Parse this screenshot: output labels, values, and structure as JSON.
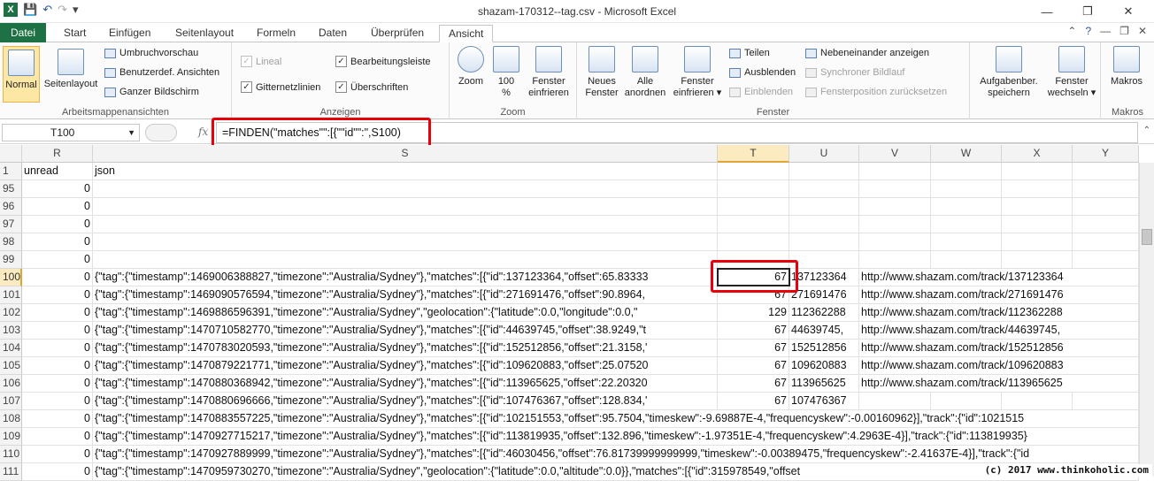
{
  "window": {
    "title": "shazam-170312--tag.csv - Microsoft Excel"
  },
  "qat": {
    "save": "💾",
    "undo": "↶",
    "redo": "↷",
    "customize": "▾"
  },
  "window_controls": {
    "min": "—",
    "restore": "❐",
    "close": "✕"
  },
  "tabs": [
    "Datei",
    "Start",
    "Einfügen",
    "Seitenlayout",
    "Formeln",
    "Daten",
    "Überprüfen",
    "Ansicht"
  ],
  "active_tab": "Ansicht",
  "ribbon": {
    "groups": {
      "arbeitsmappen": "Arbeitsmappenansichten",
      "anzeigen": "Anzeigen",
      "zoom": "Zoom",
      "fenster": "Fenster",
      "makros": "Makros"
    },
    "normal": "Normal",
    "seitenlayout": "Seitenlayout",
    "umbruch": "Umbruchvorschau",
    "benutzer": "Benutzerdef. Ansichten",
    "ganzer": "Ganzer Bildschirm",
    "lineal": "Lineal",
    "gitternetz": "Gitternetzlinien",
    "bearbeitung": "Bearbeitungsleiste",
    "ueberschriften": "Überschriften",
    "zoom": "Zoom",
    "zoom100a": "100",
    "zoom100b": "%",
    "fenster_einfrieren1": "Fenster",
    "fenster_einfrieren2": "einfrieren",
    "neues_fenster1": "Neues",
    "neues_fenster2": "Fenster",
    "alle_anordnen1": "Alle",
    "alle_anordnen2": "anordnen",
    "fenster_einfr_dd1": "Fenster",
    "fenster_einfr_dd2": "einfrieren ▾",
    "teilen": "Teilen",
    "ausblenden": "Ausblenden",
    "einblenden": "Einblenden",
    "nebeneinander": "Nebeneinander anzeigen",
    "synchron": "Synchroner Bildlauf",
    "fensterpos": "Fensterposition zurücksetzen",
    "aufgaben1": "Aufgabenber.",
    "aufgaben2": "speichern",
    "wechseln1": "Fenster",
    "wechseln2": "wechseln ▾",
    "makros": "Makros"
  },
  "formula_bar": {
    "name_box": "T100",
    "fx": "fx",
    "formula": "=FINDEN(\"matches\"\":[{\"\"id\"\":\",S100)"
  },
  "columns": [
    "R",
    "S",
    "T",
    "U",
    "V",
    "W",
    "X",
    "Y"
  ],
  "selected_column": "T",
  "header_row": {
    "row": "1",
    "R": "unread",
    "S": "json"
  },
  "rows": [
    {
      "n": "95",
      "R": "0",
      "S": "",
      "T": "",
      "U": "",
      "V": ""
    },
    {
      "n": "96",
      "R": "0",
      "S": "",
      "T": "",
      "U": "",
      "V": ""
    },
    {
      "n": "97",
      "R": "0",
      "S": "",
      "T": "",
      "U": "",
      "V": ""
    },
    {
      "n": "98",
      "R": "0",
      "S": "",
      "T": "",
      "U": "",
      "V": ""
    },
    {
      "n": "99",
      "R": "0",
      "S": "",
      "T": "",
      "U": "",
      "V": ""
    },
    {
      "n": "100",
      "R": "0",
      "S": "{\"tag\":{\"timestamp\":1469006388827,\"timezone\":\"Australia/Sydney\"},\"matches\":[{\"id\":137123364,\"offset\":65.83333",
      "T": "67",
      "U": "137123364",
      "V": "http://www.shazam.com/track/137123364"
    },
    {
      "n": "101",
      "R": "0",
      "S": "{\"tag\":{\"timestamp\":1469090576594,\"timezone\":\"Australia/Sydney\"},\"matches\":[{\"id\":271691476,\"offset\":90.8964,",
      "T": "67",
      "U": "271691476",
      "V": "http://www.shazam.com/track/271691476"
    },
    {
      "n": "102",
      "R": "0",
      "S": "{\"tag\":{\"timestamp\":1469886596391,\"timezone\":\"Australia/Sydney\",\"geolocation\":{\"latitude\":0.0,\"longitude\":0.0,\"",
      "T": "129",
      "U": "112362288",
      "V": "http://www.shazam.com/track/112362288"
    },
    {
      "n": "103",
      "R": "0",
      "S": "{\"tag\":{\"timestamp\":1470710582770,\"timezone\":\"Australia/Sydney\"},\"matches\":[{\"id\":44639745,\"offset\":38.9249,\"t",
      "T": "67",
      "U": "44639745,",
      "V": "http://www.shazam.com/track/44639745,"
    },
    {
      "n": "104",
      "R": "0",
      "S": "{\"tag\":{\"timestamp\":1470783020593,\"timezone\":\"Australia/Sydney\"},\"matches\":[{\"id\":152512856,\"offset\":21.3158,'",
      "T": "67",
      "U": "152512856",
      "V": "http://www.shazam.com/track/152512856"
    },
    {
      "n": "105",
      "R": "0",
      "S": "{\"tag\":{\"timestamp\":1470879221771,\"timezone\":\"Australia/Sydney\"},\"matches\":[{\"id\":109620883,\"offset\":25.07520",
      "T": "67",
      "U": "109620883",
      "V": "http://www.shazam.com/track/109620883"
    },
    {
      "n": "106",
      "R": "0",
      "S": "{\"tag\":{\"timestamp\":1470880368942,\"timezone\":\"Australia/Sydney\"},\"matches\":[{\"id\":113965625,\"offset\":22.20320",
      "T": "67",
      "U": "113965625",
      "V": "http://www.shazam.com/track/113965625"
    },
    {
      "n": "107",
      "R": "0",
      "S": "{\"tag\":{\"timestamp\":1470880696666,\"timezone\":\"Australia/Sydney\"},\"matches\":[{\"id\":107476367,\"offset\":128.834,'",
      "T": "67",
      "U": "107476367",
      "V": ""
    },
    {
      "n": "108",
      "R": "0",
      "S": "{\"tag\":{\"timestamp\":1470883557225,\"timezone\":\"Australia/Sydney\"},\"matches\":[{\"id\":102151553,\"offset\":95.7504,\"timeskew\":-9.69887E-4,\"frequencyskew\":-0.00160962}],\"track\":{\"id\":1021515",
      "T": "",
      "U": "",
      "V": ""
    },
    {
      "n": "109",
      "R": "0",
      "S": "{\"tag\":{\"timestamp\":1470927715217,\"timezone\":\"Australia/Sydney\"},\"matches\":[{\"id\":113819935,\"offset\":132.896,\"timeskew\":-1.97351E-4,\"frequencyskew\":4.2963E-4}],\"track\":{\"id\":113819935}",
      "T": "",
      "U": "",
      "V": ""
    },
    {
      "n": "110",
      "R": "0",
      "S": "{\"tag\":{\"timestamp\":1470927889999,\"timezone\":\"Australia/Sydney\"},\"matches\":[{\"id\":46030456,\"offset\":76.81739999999999,\"timeskew\":-0.00389475,\"frequencyskew\":-2.41637E-4}],\"track\":{\"id",
      "T": "",
      "U": "",
      "V": ""
    },
    {
      "n": "111",
      "R": "0",
      "S": "{\"tag\":{\"timestamp\":1470959730270,\"timezone\":\"Australia/Sydney\",\"geolocation\":{\"latitude\":0.0,\"altitude\":0.0}},\"matches\":[{\"id\":315978549,\"offset",
      "T": "",
      "U": "",
      "V": ""
    }
  ],
  "active_row": "100",
  "watermark": "(c) 2017 www.thinkoholic.com"
}
